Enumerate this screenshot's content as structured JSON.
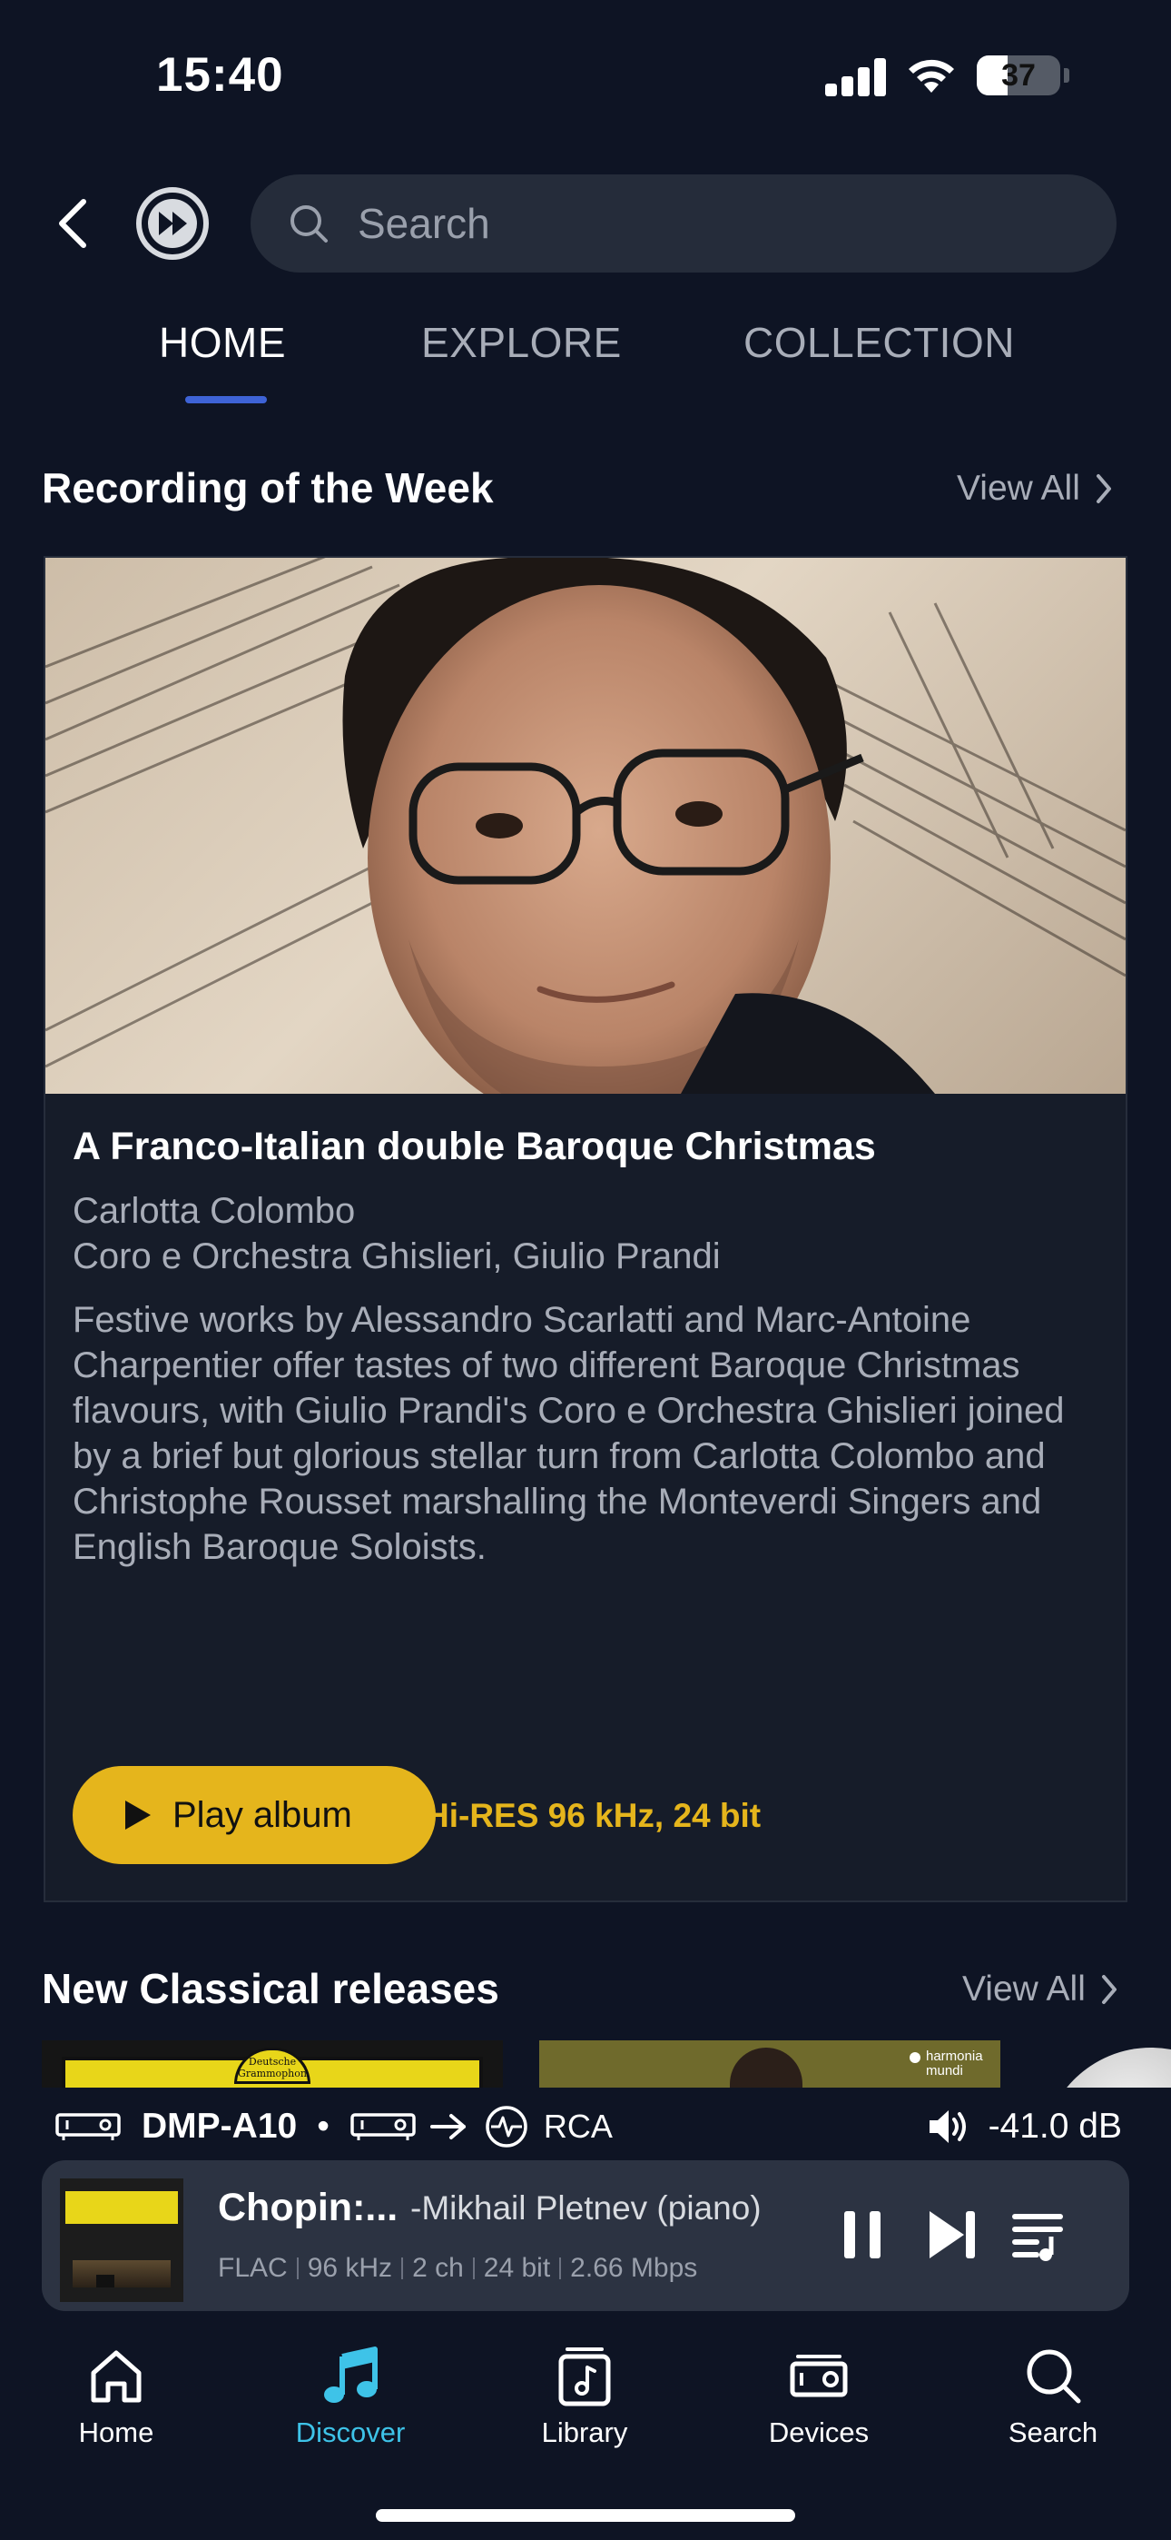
{
  "status": {
    "time": "15:40",
    "battery": "37"
  },
  "search": {
    "placeholder": "Search"
  },
  "tabs": [
    {
      "label": "HOME",
      "active": true
    },
    {
      "label": "EXPLORE",
      "active": false
    },
    {
      "label": "COLLECTION",
      "active": false
    }
  ],
  "recording": {
    "section_title": "Recording of the Week",
    "view_all": "View All",
    "title": "A Franco-Italian double Baroque Christmas",
    "artist_line1": "Carlotta Colombo",
    "artist_line2": "Coro e Orchestra Ghislieri, Giulio Prandi",
    "description": "Festive works by Alessandro Scarlatti and Marc-Antoine Charpentier offer tastes of two different Baroque Christmas flavours, with Giulio Prandi's Coro e Orchestra Ghislieri joined by a brief but glorious stellar turn from Carlotta Colombo and Christophe Rousset marshalling the Monteverdi Singers and English Baroque Soloists.",
    "play_label": "Play album",
    "quality": "Hi-RES 96 kHz, 24 bit"
  },
  "new_releases": {
    "section_title": "New Classical releases",
    "view_all": "View All",
    "items": [
      {
        "label": "Deutsche Grammophon"
      },
      {
        "label": "harmonia mundi"
      }
    ]
  },
  "now_playing": {
    "device": "DMP-A10",
    "output": "RCA",
    "volume": "-41.0 dB",
    "title": "Chopin:...",
    "artist": "-Mikhail Pletnev (piano)",
    "format": "FLAC",
    "sample_rate": "96 kHz",
    "channels": "2 ch",
    "bit_depth": "24 bit",
    "bitrate": "2.66 Mbps"
  },
  "bottom_nav": {
    "home": "Home",
    "discover": "Discover",
    "library": "Library",
    "devices": "Devices",
    "search": "Search"
  },
  "colors": {
    "background": "#0e1424",
    "accent_yellow": "#e5b51c",
    "tab_indicator": "#3e63d6",
    "discover_active": "#3ec3e8"
  }
}
